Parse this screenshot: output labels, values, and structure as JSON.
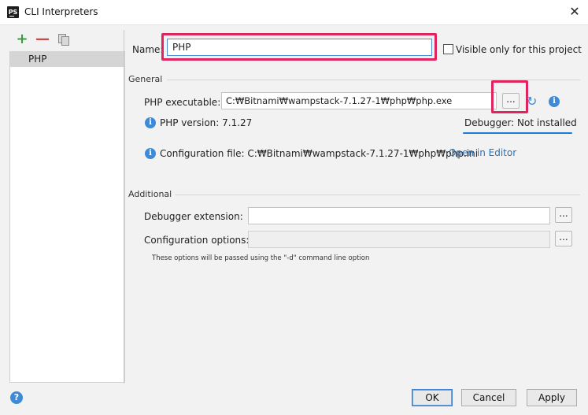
{
  "window": {
    "title": "CLI Interpreters",
    "app_icon_text": "PS",
    "close_glyph": "✕"
  },
  "sidebar": {
    "toolbar": {
      "add_glyph": "+",
      "remove_glyph": "—"
    },
    "items": [
      {
        "label": "PHP",
        "selected": true
      }
    ]
  },
  "form": {
    "name_label": "Name:",
    "name_value": "PHP",
    "visible_only_label": "Visible only for this project",
    "visible_only_checked": false,
    "general_section": "General",
    "php_executable_label": "PHP executable:",
    "php_executable_value": "C:₩Bitnami₩wampstack-7.1.27-1₩php₩php.exe",
    "browse_label": "...",
    "php_version_text": "PHP version: 7.1.27",
    "debugger_text": "Debugger: Not installed",
    "config_file_text": "Configuration file: C:₩Bitnami₩wampstack-7.1.27-1₩php₩php.ini",
    "open_in_editor_label": "Open in Editor",
    "additional_section": "Additional",
    "debugger_extension_label": "Debugger extension:",
    "debugger_extension_value": "",
    "configuration_options_label": "Configuration options:",
    "configuration_options_value": "",
    "configuration_options_hint": "These options will be passed using the \"-d\" command line option"
  },
  "footer": {
    "help_glyph": "?",
    "ok_label": "OK",
    "cancel_label": "Cancel",
    "apply_label": "Apply"
  },
  "icons": {
    "info_glyph": "i",
    "reload_glyph": "↻"
  },
  "colors": {
    "highlight": "#e0245e",
    "underline": "#1a7cd8",
    "link": "#2c6fb8",
    "accent": "#3d8bd6"
  }
}
